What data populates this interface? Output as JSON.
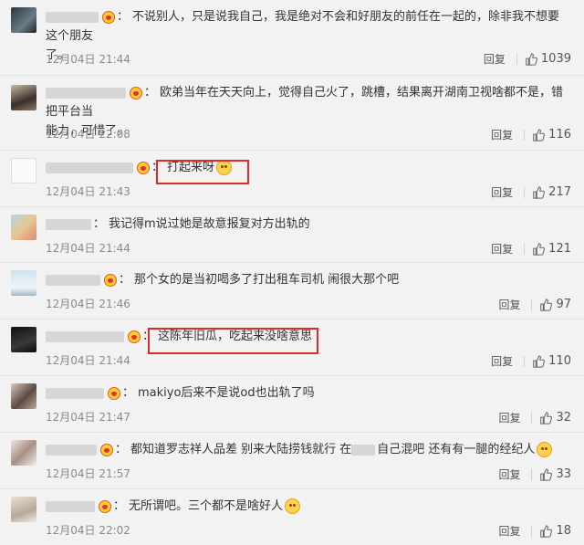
{
  "comments": [
    {
      "text_part1": "不说别人，只是说我自己，我是绝对不会和好朋友的前任在一起的，除非我不想要这个朋友",
      "text_part2": "了。",
      "time": "12月04日 21:44",
      "reply": "回复",
      "likes": "1039"
    },
    {
      "text_part1": "欧弟当年在天天向上，觉得自己火了，跳槽，结果离开湖南卫视啥都不是，错把平台当",
      "text_part2": "能力，可惜了。",
      "time": "12月04日 22:08",
      "reply": "回复",
      "likes": "116"
    },
    {
      "text_part1": "打起来呀",
      "text_part2": "",
      "time": "12月04日 21:43",
      "reply": "回复",
      "likes": "217"
    },
    {
      "text_part1": "我记得m说过她是故意报复对方出轨的",
      "text_part2": "",
      "time": "12月04日 21:44",
      "reply": "回复",
      "likes": "121"
    },
    {
      "text_part1": "那个女的是当初喝多了打出租车司机 闹很大那个吧",
      "text_part2": "",
      "time": "12月04日 21:46",
      "reply": "回复",
      "likes": "97"
    },
    {
      "text_part1": "这陈年旧瓜，吃起来没啥意思",
      "text_part2": "",
      "time": "12月04日 21:44",
      "reply": "回复",
      "likes": "110"
    },
    {
      "text_part1": "makiyo后来不是说od也出轨了吗",
      "text_part2": "",
      "time": "12月04日 21:47",
      "reply": "回复",
      "likes": "32"
    },
    {
      "text_part1": "都知道罗志祥人品差 别来大陆捞钱就行 在",
      "text_part1b": "自己混吧 还有有一腿的经纪人",
      "text_part2": "",
      "time": "12月04日 21:57",
      "reply": "回复",
      "likes": "33"
    },
    {
      "text_part1": "无所谓吧。三个都不是啥好人",
      "text_part2": "",
      "time": "12月04日 22:02",
      "reply": "回复",
      "likes": "18"
    }
  ],
  "colors": {
    "highlight": "#e02a2a",
    "badge": "#ffcc33"
  },
  "icons": {
    "like": "thumbs-up-icon",
    "badge": "vip-badge-icon",
    "emoji": "smile-emoji-icon"
  }
}
